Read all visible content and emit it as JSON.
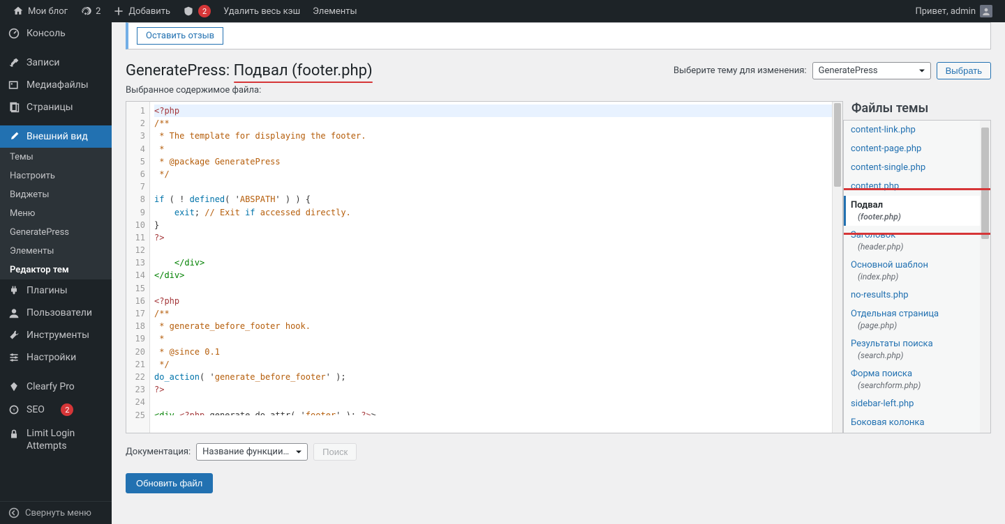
{
  "admin_bar": {
    "site": "Мои блог",
    "updates": "2",
    "add": "Добавить",
    "security_count": "2",
    "cache": "Удалить весь кэш",
    "elements": "Элементы",
    "greeting": "Привет, admin"
  },
  "sidebar": {
    "console": "Консоль",
    "posts": "Записи",
    "media": "Медиафайлы",
    "pages": "Страницы",
    "appearance": "Внешний вид",
    "sub": {
      "themes": "Темы",
      "customize": "Настроить",
      "widgets": "Виджеты",
      "menus": "Меню",
      "gp": "GeneratePress",
      "elements": "Элементы",
      "editor": "Редактор тем"
    },
    "plugins": "Плагины",
    "users": "Пользователи",
    "tools": "Инструменты",
    "settings": "Настройки",
    "clearfy": "Clearfy Pro",
    "seo": "SEO",
    "seo_count": "2",
    "limit_login": "Limit Login Attempts",
    "collapse": "Свернуть меню"
  },
  "notice": {
    "link": "Оставить отзыв"
  },
  "page": {
    "title_prefix": "GeneratePress:",
    "title_main": "Подвал (footer.php)",
    "subtitle": "Выбранное содержимое файла:"
  },
  "picker": {
    "label": "Выберите тему для изменения:",
    "selected": "GeneratePress",
    "button": "Выбрать"
  },
  "files": {
    "title": "Файлы темы",
    "items": [
      {
        "name": "content-link.php"
      },
      {
        "name": "content-page.php"
      },
      {
        "name": "content-single.php"
      },
      {
        "name": "content.php"
      },
      {
        "name": "Подвал",
        "sub": "(footer.php)",
        "active": true
      },
      {
        "name": "Заголовок",
        "sub": "(header.php)"
      },
      {
        "name": "Основной шаблон",
        "sub": "(index.php)"
      },
      {
        "name": "no-results.php"
      },
      {
        "name": "Отдельная страница",
        "sub": "(page.php)"
      },
      {
        "name": "Результаты поиска",
        "sub": "(search.php)"
      },
      {
        "name": "Форма поиска",
        "sub": "(searchform.php)"
      },
      {
        "name": "sidebar-left.php"
      },
      {
        "name": "Боковая колонка"
      }
    ]
  },
  "code_lines": [
    "<?php",
    "/**",
    " * The template for displaying the footer.",
    " *",
    " * @package GeneratePress",
    " */",
    "",
    "if ( ! defined( 'ABSPATH' ) ) {",
    "    exit; // Exit if accessed directly.",
    "}",
    "?>",
    "",
    "    </div>",
    "</div>",
    "",
    "<?php",
    "/**",
    " * generate_before_footer hook.",
    " *",
    " * @since 0.1",
    " */",
    "do_action( 'generate_before_footer' );",
    "?>",
    "",
    "<div <?php generate do attr( 'footer' ); ?>>"
  ],
  "doc": {
    "label": "Документация:",
    "placeholder": "Название функции…",
    "search": "Поиск"
  },
  "update_btn": "Обновить файл"
}
